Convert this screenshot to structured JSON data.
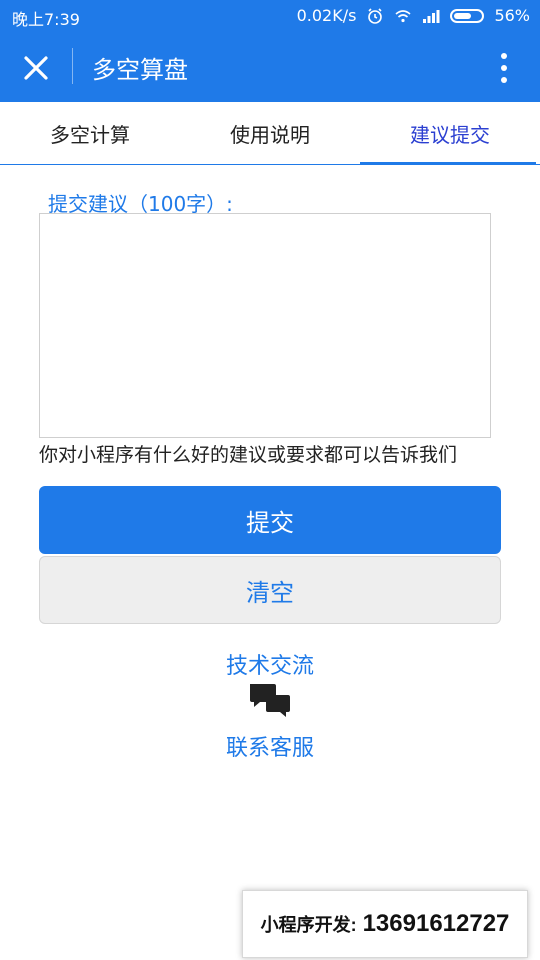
{
  "status_bar": {
    "time": "晚上7:39",
    "speed": "0.02K/s",
    "battery": "56%"
  },
  "header": {
    "title": "多空算盘"
  },
  "tabs": [
    {
      "label": "多空计算"
    },
    {
      "label": "使用说明"
    },
    {
      "label": "建议提交"
    }
  ],
  "form": {
    "label": "提交建议（100字）:",
    "textarea_value": "",
    "hint": "你对小程序有什么好的建议或要求都可以告诉我们",
    "submit_label": "提交",
    "clear_label": "清空"
  },
  "support": {
    "tech_label": "技术交流",
    "service_label": "联系客服"
  },
  "footer_badge": {
    "label": "小程序开发:",
    "phone": "13691612727"
  },
  "colors": {
    "primary": "#1f7ae8",
    "active_tab_text": "#2b3fd1"
  }
}
